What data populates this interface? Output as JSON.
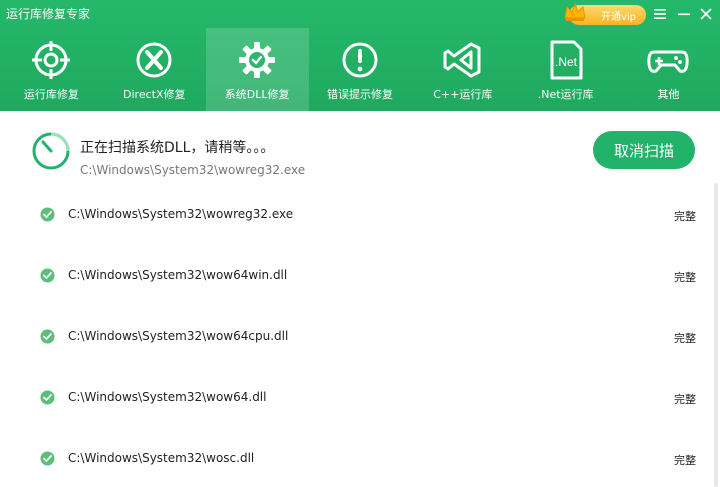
{
  "window": {
    "title": "运行库修复专家"
  },
  "vip": {
    "label": "开通vip"
  },
  "nav": {
    "tabs": [
      {
        "label": "运行库修复",
        "icon": "crosshair-target-icon"
      },
      {
        "label": "DirectX修复",
        "icon": "directx-logo-icon"
      },
      {
        "label": "系统DLL修复",
        "icon": "gear-check-icon"
      },
      {
        "label": "错误提示修复",
        "icon": "exclamation-circle-icon"
      },
      {
        "label": "C++运行库",
        "icon": "visual-studio-icon"
      },
      {
        "label": ".Net运行库",
        "icon": "dotnet-document-icon"
      },
      {
        "label": "其他",
        "icon": "gamepad-icon"
      }
    ],
    "active_index": 2
  },
  "scan": {
    "status": "正在扫描系统DLL，请稍等。。。",
    "current_path": "C:\\Windows\\System32\\wowreg32.exe",
    "cancel_label": "取消扫描"
  },
  "files": [
    {
      "path": "C:\\Windows\\System32\\wowreg32.exe",
      "status": "完整"
    },
    {
      "path": "C:\\Windows\\System32\\wow64win.dll",
      "status": "完整"
    },
    {
      "path": "C:\\Windows\\System32\\wow64cpu.dll",
      "status": "完整"
    },
    {
      "path": "C:\\Windows\\System32\\wow64.dll",
      "status": "完整"
    },
    {
      "path": "C:\\Windows\\System32\\wosc.dll",
      "status": "完整"
    }
  ],
  "colors": {
    "brand_green": "#23b26a",
    "check_green": "#5bbf7a"
  }
}
